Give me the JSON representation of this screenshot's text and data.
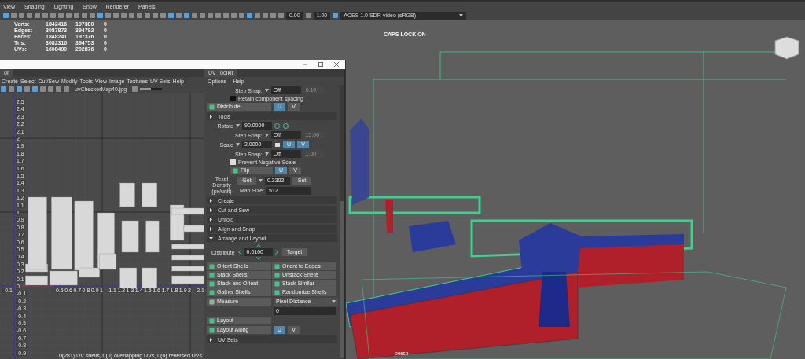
{
  "viewport_menu": [
    "View",
    "Shading",
    "Lighting",
    "Show",
    "Renderer",
    "Panels"
  ],
  "viewport_toolbar": {
    "icons": [
      {
        "on": true
      },
      {
        "on": false
      },
      {
        "on": false
      },
      {
        "on": false
      },
      {
        "on": false
      },
      {
        "on": false
      },
      {
        "on": false
      },
      {
        "on": false
      },
      {
        "on": false
      },
      {
        "on": false
      },
      {
        "on": false
      },
      {
        "on": false
      },
      {
        "on": true
      },
      {
        "on": false
      },
      {
        "on": false
      },
      {
        "on": false
      },
      {
        "on": false
      },
      {
        "on": false
      },
      {
        "on": false
      },
      {
        "on": false
      },
      {
        "on": false
      },
      {
        "on": true
      },
      {
        "on": false
      },
      {
        "on": true
      },
      {
        "on": false
      },
      {
        "on": false
      },
      {
        "on": false
      },
      {
        "on": false
      },
      {
        "on": false
      },
      {
        "on": false
      },
      {
        "on": false
      },
      {
        "on": true
      },
      {
        "on": false
      },
      {
        "on": false
      },
      {
        "on": false
      },
      {
        "on": false
      }
    ],
    "exposure": "0.00",
    "gamma": "1.00",
    "color_space": "ACES 1.0 SDR-video (sRGB)"
  },
  "hud_stats": [
    {
      "label": "Verts:",
      "values": [
        "1842416",
        "197380",
        "0"
      ]
    },
    {
      "label": "Edges:",
      "values": [
        "3087873",
        "394792",
        "0"
      ]
    },
    {
      "label": "Faces:",
      "values": [
        "1848241",
        "197376",
        "0"
      ]
    },
    {
      "label": "Tris:",
      "values": [
        "3082316",
        "394753",
        "0"
      ]
    },
    {
      "label": "UVs:",
      "values": [
        "1608490",
        "202876",
        "0"
      ]
    }
  ],
  "caps_lock": "CAPS LOCK ON",
  "camera_label": "persp",
  "uv_editor": {
    "tab": "or",
    "menu": [
      "Create",
      "Select",
      "Cut/Sew",
      "Modify",
      "Tools",
      "View",
      "Image",
      "Textures",
      "UV Sets",
      "Help"
    ],
    "image": "uvCheckerMap40.jpg",
    "exposure_slider": {
      "level": 0.5
    },
    "v_ticks": [
      "2.5",
      "2.4",
      "2.3",
      "2.2",
      "2.1",
      "2",
      "1.9",
      "1.8",
      "1.7",
      "1.6",
      "1.5",
      "1.4",
      "1.3",
      "1.2",
      "1.1",
      "1",
      "0.9",
      "0.8",
      "0.7",
      "0.6",
      "0.5",
      "0.4",
      "0.3",
      "0.2",
      "0.1",
      "0",
      "-0.1",
      "-0.2",
      "-0.3",
      "-0.4",
      "-0.5",
      "-0.6",
      "-0.7",
      "-0.8",
      "-0.9"
    ],
    "u_ticks": [
      "-0.1",
      "0.5",
      "0.6",
      "0.7",
      "0.8",
      "0.9",
      "1",
      "1.1",
      "1.2",
      "1.3",
      "1.4",
      "1.5",
      "1.6",
      "1.7",
      "1.8",
      "1.9",
      "2",
      "2.1"
    ],
    "status": "0(281) UV shells, 0(0) overlapping UVs, 0(0) reversed UVs"
  },
  "uv_toolkit": {
    "tab": "UV Toolkit",
    "menu": [
      "Options",
      "Help"
    ],
    "rows": [
      {
        "kind": "snap",
        "label": "Step Snap:",
        "value": "Off",
        "amount": "0.10"
      },
      {
        "kind": "checkbox",
        "label": "Retain component spacing",
        "checked": false
      },
      {
        "kind": "toggle",
        "label": "Distribute",
        "u": "U",
        "v": "V",
        "u_selected": true,
        "v_selected": false
      },
      {
        "kind": "section",
        "title": "Tools",
        "expanded": false
      },
      {
        "kind": "rotate",
        "label": "Rotate",
        "value": "90.0000"
      },
      {
        "kind": "snap",
        "label": "Step Snap:",
        "value": "Off",
        "amount": "15.00"
      },
      {
        "kind": "scale",
        "label": "Scale",
        "value": "2.0000",
        "u": "U",
        "v": "V",
        "u_selected": true,
        "v_selected": true
      },
      {
        "kind": "snap",
        "label": "Step Snap:",
        "value": "Off",
        "amount": "1.00"
      },
      {
        "kind": "checkbox",
        "label": "Prevent Negative Scale",
        "checked": true
      },
      {
        "kind": "toggle",
        "label": "Flip",
        "u": "U",
        "v": "V",
        "u_selected": true,
        "v_selected": false
      },
      {
        "kind": "texel",
        "label": "Texel Density (px/unit)",
        "get": "Get",
        "value": "0.3302",
        "set": "Set",
        "map_label": "Map Size:",
        "map_value": "512"
      },
      {
        "kind": "section",
        "title": "Create",
        "expanded": false
      },
      {
        "kind": "section",
        "title": "Cut and Sew",
        "expanded": false
      },
      {
        "kind": "section",
        "title": "Unfold",
        "expanded": false
      },
      {
        "kind": "section",
        "title": "Align and Snap",
        "expanded": false
      },
      {
        "kind": "section",
        "title": "Arrange and Layout",
        "expanded": true
      },
      {
        "kind": "distribute",
        "label": "Distribute",
        "value": "0.0100",
        "target": "Target"
      },
      {
        "kind": "grid",
        "buttons": [
          "Orient Shells",
          "Orient to Edges",
          "Stack Shells",
          "Unstack Shells",
          "Stack and Orient",
          "Stack Similar",
          "Gather Shells",
          "Randomize Shells"
        ]
      },
      {
        "kind": "measure",
        "label": "Measure",
        "option": "Pixel Distance",
        "value": "0"
      },
      {
        "kind": "button",
        "label": "Layout"
      },
      {
        "kind": "toggle",
        "label": "Layout Along",
        "u": "U",
        "v": "V",
        "u_selected": true,
        "v_selected": false
      },
      {
        "kind": "section",
        "title": "UV Sets",
        "expanded": false
      }
    ]
  }
}
